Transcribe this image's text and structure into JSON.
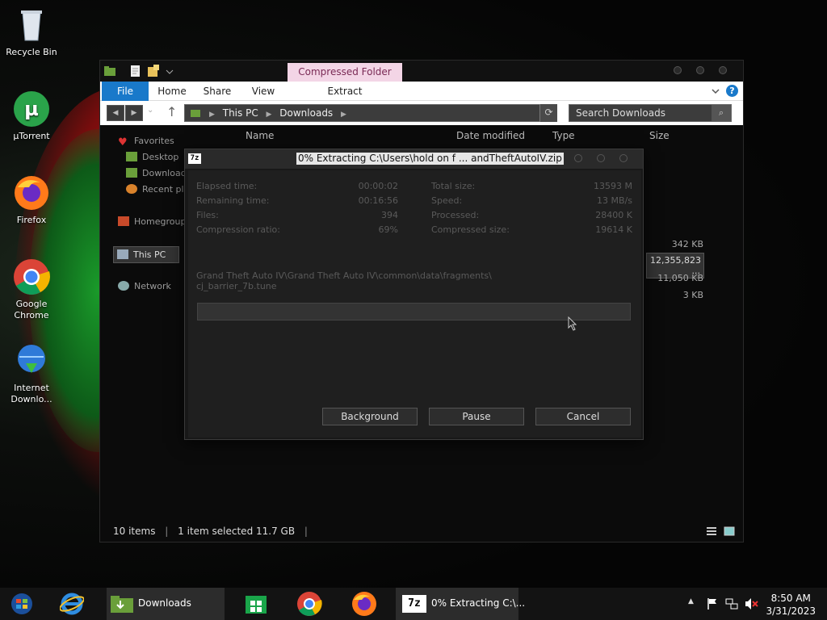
{
  "desktop": {
    "icons": [
      {
        "label": "Recycle Bin",
        "icon": "recycle-bin-icon"
      },
      {
        "label": "µTorrent",
        "icon": "utorrent-icon"
      },
      {
        "label": "Firefox",
        "icon": "firefox-icon"
      },
      {
        "label": "Google Chrome",
        "icon": "chrome-icon"
      },
      {
        "label": "Internet Downlo...",
        "icon": "internet-download-manager-icon"
      }
    ]
  },
  "explorer": {
    "context_tab": "Compressed Folder Tools",
    "ribbon_tabs": [
      "File",
      "Home",
      "Share",
      "View",
      "Extract"
    ],
    "address": {
      "segments": [
        "This PC",
        "Downloads"
      ]
    },
    "search": {
      "placeholder": "Search Downloads"
    },
    "columns": [
      "Name",
      "Date modified",
      "Type",
      "Size"
    ],
    "nav": [
      {
        "label": "Favorites"
      },
      {
        "label": "Desktop"
      },
      {
        "label": "Downloads"
      },
      {
        "label": "Recent places"
      },
      {
        "label": "Homegroup"
      },
      {
        "label": "This PC"
      },
      {
        "label": "Network"
      }
    ],
    "sizes": [
      "342 KB",
      "12,355,823 ...",
      "11,050 KB",
      "3 KB"
    ],
    "status": {
      "items": "10 items",
      "selected": "1 item selected  11.7 GB"
    }
  },
  "dialog": {
    "title": "0% Extracting C:\\Users\\hold on f ... andTheftAutoIV.zip",
    "stats_left": [
      {
        "label": "Elapsed time:",
        "value": "00:00:02"
      },
      {
        "label": "Remaining time:",
        "value": "00:16:56"
      },
      {
        "label": "Files:",
        "value": "394"
      },
      {
        "label": "Compression ratio:",
        "value": "69%"
      }
    ],
    "stats_right": [
      {
        "label": "Total size:",
        "value": "13593 M"
      },
      {
        "label": "Speed:",
        "value": "13 MB/s"
      },
      {
        "label": "Processed:",
        "value": "28400 K"
      },
      {
        "label": "Compressed size:",
        "value": "19614 K"
      }
    ],
    "path_line1": "Grand Theft Auto IV\\Grand Theft Auto IV\\common\\data\\fragments\\",
    "path_line2": "cj_barrier_7b.tune",
    "progress": 0,
    "buttons": {
      "background": "Background",
      "pause": "Pause",
      "cancel": "Cancel"
    }
  },
  "taskbar": {
    "downloads_label": "Downloads",
    "extract_label": "0% Extracting C:\\...",
    "time": "8:50 AM",
    "date": "3/31/2023"
  }
}
